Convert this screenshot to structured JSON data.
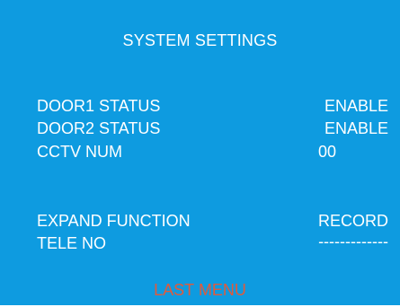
{
  "title": "SYSTEM SETTINGS",
  "settings": [
    {
      "label": "DOOR1 STATUS",
      "value": "ENABLE"
    },
    {
      "label": "DOOR2 STATUS",
      "value": "ENABLE"
    },
    {
      "label": "CCTV NUM",
      "value": "00"
    },
    {
      "label": "EXPAND FUNCTION",
      "value": "RECORD"
    },
    {
      "label": "TELE NO",
      "value": "-------------"
    }
  ],
  "footer": {
    "last_menu_label": "LAST MENU"
  },
  "colors": {
    "background": "#0e9be0",
    "text": "#ffffff",
    "highlight": "#e05a3c"
  }
}
